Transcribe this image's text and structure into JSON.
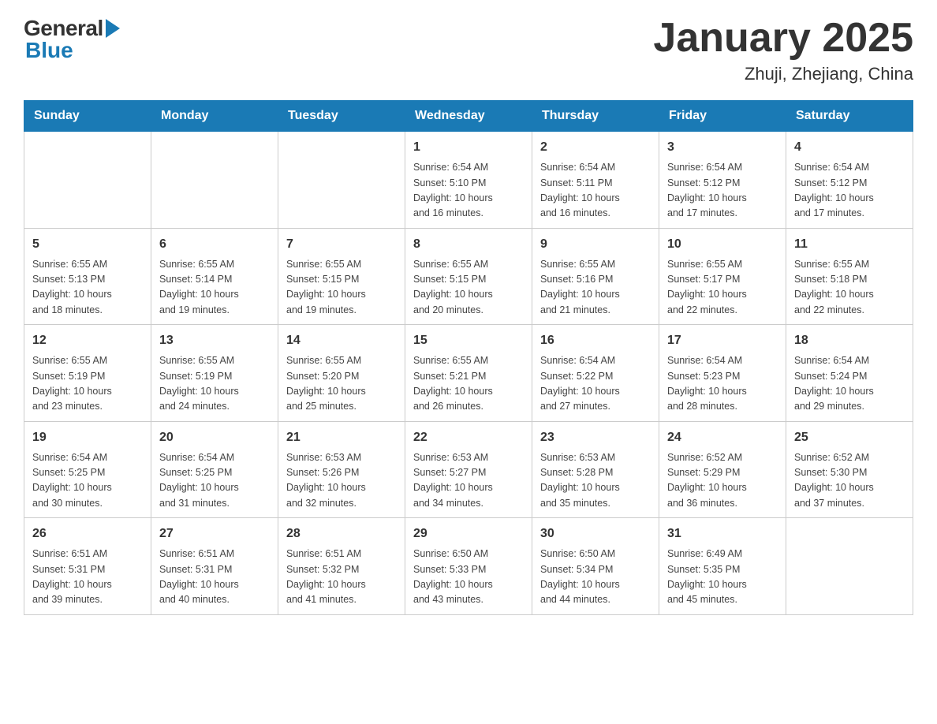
{
  "header": {
    "title": "January 2025",
    "subtitle": "Zhuji, Zhejiang, China",
    "logo_general": "General",
    "logo_blue": "Blue"
  },
  "calendar": {
    "days_of_week": [
      "Sunday",
      "Monday",
      "Tuesday",
      "Wednesday",
      "Thursday",
      "Friday",
      "Saturday"
    ],
    "weeks": [
      [
        {
          "day": "",
          "info": ""
        },
        {
          "day": "",
          "info": ""
        },
        {
          "day": "",
          "info": ""
        },
        {
          "day": "1",
          "info": "Sunrise: 6:54 AM\nSunset: 5:10 PM\nDaylight: 10 hours\nand 16 minutes."
        },
        {
          "day": "2",
          "info": "Sunrise: 6:54 AM\nSunset: 5:11 PM\nDaylight: 10 hours\nand 16 minutes."
        },
        {
          "day": "3",
          "info": "Sunrise: 6:54 AM\nSunset: 5:12 PM\nDaylight: 10 hours\nand 17 minutes."
        },
        {
          "day": "4",
          "info": "Sunrise: 6:54 AM\nSunset: 5:12 PM\nDaylight: 10 hours\nand 17 minutes."
        }
      ],
      [
        {
          "day": "5",
          "info": "Sunrise: 6:55 AM\nSunset: 5:13 PM\nDaylight: 10 hours\nand 18 minutes."
        },
        {
          "day": "6",
          "info": "Sunrise: 6:55 AM\nSunset: 5:14 PM\nDaylight: 10 hours\nand 19 minutes."
        },
        {
          "day": "7",
          "info": "Sunrise: 6:55 AM\nSunset: 5:15 PM\nDaylight: 10 hours\nand 19 minutes."
        },
        {
          "day": "8",
          "info": "Sunrise: 6:55 AM\nSunset: 5:15 PM\nDaylight: 10 hours\nand 20 minutes."
        },
        {
          "day": "9",
          "info": "Sunrise: 6:55 AM\nSunset: 5:16 PM\nDaylight: 10 hours\nand 21 minutes."
        },
        {
          "day": "10",
          "info": "Sunrise: 6:55 AM\nSunset: 5:17 PM\nDaylight: 10 hours\nand 22 minutes."
        },
        {
          "day": "11",
          "info": "Sunrise: 6:55 AM\nSunset: 5:18 PM\nDaylight: 10 hours\nand 22 minutes."
        }
      ],
      [
        {
          "day": "12",
          "info": "Sunrise: 6:55 AM\nSunset: 5:19 PM\nDaylight: 10 hours\nand 23 minutes."
        },
        {
          "day": "13",
          "info": "Sunrise: 6:55 AM\nSunset: 5:19 PM\nDaylight: 10 hours\nand 24 minutes."
        },
        {
          "day": "14",
          "info": "Sunrise: 6:55 AM\nSunset: 5:20 PM\nDaylight: 10 hours\nand 25 minutes."
        },
        {
          "day": "15",
          "info": "Sunrise: 6:55 AM\nSunset: 5:21 PM\nDaylight: 10 hours\nand 26 minutes."
        },
        {
          "day": "16",
          "info": "Sunrise: 6:54 AM\nSunset: 5:22 PM\nDaylight: 10 hours\nand 27 minutes."
        },
        {
          "day": "17",
          "info": "Sunrise: 6:54 AM\nSunset: 5:23 PM\nDaylight: 10 hours\nand 28 minutes."
        },
        {
          "day": "18",
          "info": "Sunrise: 6:54 AM\nSunset: 5:24 PM\nDaylight: 10 hours\nand 29 minutes."
        }
      ],
      [
        {
          "day": "19",
          "info": "Sunrise: 6:54 AM\nSunset: 5:25 PM\nDaylight: 10 hours\nand 30 minutes."
        },
        {
          "day": "20",
          "info": "Sunrise: 6:54 AM\nSunset: 5:25 PM\nDaylight: 10 hours\nand 31 minutes."
        },
        {
          "day": "21",
          "info": "Sunrise: 6:53 AM\nSunset: 5:26 PM\nDaylight: 10 hours\nand 32 minutes."
        },
        {
          "day": "22",
          "info": "Sunrise: 6:53 AM\nSunset: 5:27 PM\nDaylight: 10 hours\nand 34 minutes."
        },
        {
          "day": "23",
          "info": "Sunrise: 6:53 AM\nSunset: 5:28 PM\nDaylight: 10 hours\nand 35 minutes."
        },
        {
          "day": "24",
          "info": "Sunrise: 6:52 AM\nSunset: 5:29 PM\nDaylight: 10 hours\nand 36 minutes."
        },
        {
          "day": "25",
          "info": "Sunrise: 6:52 AM\nSunset: 5:30 PM\nDaylight: 10 hours\nand 37 minutes."
        }
      ],
      [
        {
          "day": "26",
          "info": "Sunrise: 6:51 AM\nSunset: 5:31 PM\nDaylight: 10 hours\nand 39 minutes."
        },
        {
          "day": "27",
          "info": "Sunrise: 6:51 AM\nSunset: 5:31 PM\nDaylight: 10 hours\nand 40 minutes."
        },
        {
          "day": "28",
          "info": "Sunrise: 6:51 AM\nSunset: 5:32 PM\nDaylight: 10 hours\nand 41 minutes."
        },
        {
          "day": "29",
          "info": "Sunrise: 6:50 AM\nSunset: 5:33 PM\nDaylight: 10 hours\nand 43 minutes."
        },
        {
          "day": "30",
          "info": "Sunrise: 6:50 AM\nSunset: 5:34 PM\nDaylight: 10 hours\nand 44 minutes."
        },
        {
          "day": "31",
          "info": "Sunrise: 6:49 AM\nSunset: 5:35 PM\nDaylight: 10 hours\nand 45 minutes."
        },
        {
          "day": "",
          "info": ""
        }
      ]
    ]
  }
}
